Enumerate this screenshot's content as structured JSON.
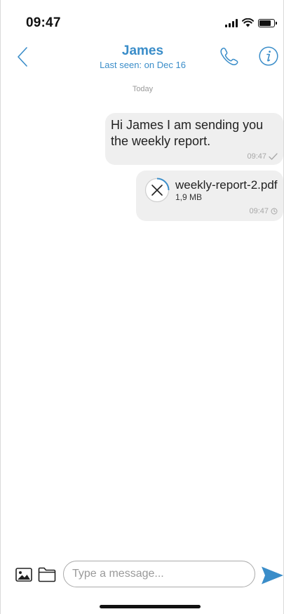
{
  "status_bar": {
    "time": "09:47",
    "icons": [
      "signal-icon",
      "wifi-icon",
      "battery-icon"
    ]
  },
  "header": {
    "contact_name": "James",
    "last_seen": "Last seen: on Dec 16",
    "icons": [
      "back-chevron-icon",
      "phone-icon",
      "info-icon"
    ],
    "accent_color": "#3a8dc9"
  },
  "chat": {
    "day_label": "Today",
    "messages": [
      {
        "type": "text",
        "text": "Hi James I am sending you the weekly report.",
        "time": "09:47",
        "status_icon": "checkmark-icon"
      },
      {
        "type": "file",
        "file_name": "weekly-report-2.pdf",
        "file_size": "1,9 MB",
        "time": "09:47",
        "status_icon": "clock-icon",
        "file_icon": "cancel-upload-icon"
      }
    ],
    "bubble_color": "#efefef"
  },
  "composer": {
    "placeholder": "Type a message...",
    "value": "",
    "icons": [
      "image-icon",
      "folder-icon",
      "send-icon"
    ],
    "send_color": "#3a8dc9"
  }
}
